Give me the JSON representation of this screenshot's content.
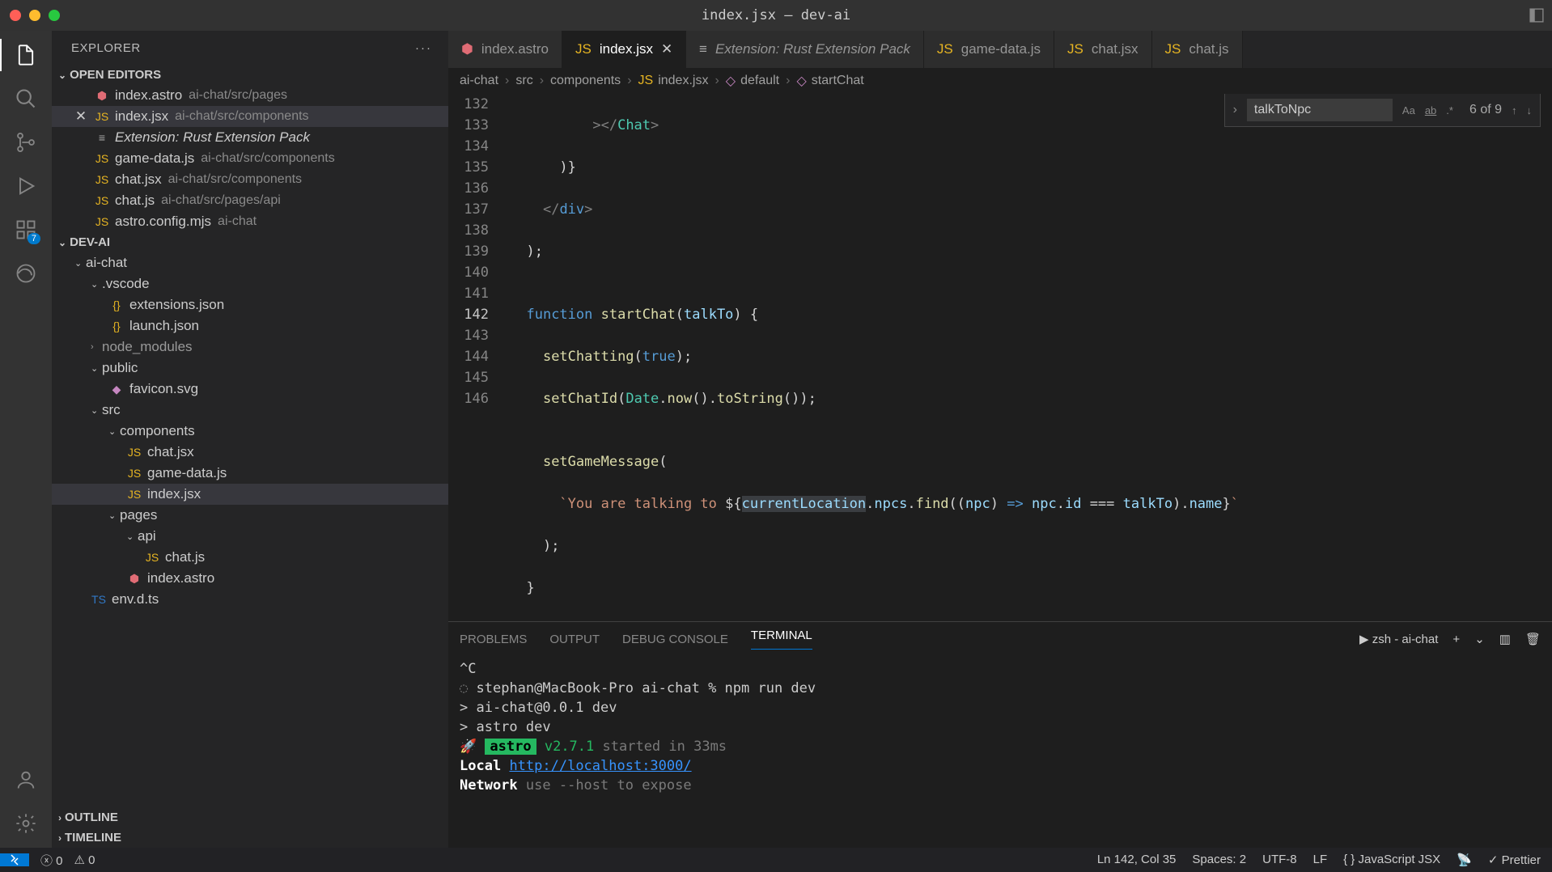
{
  "window": {
    "title": "index.jsx — dev-ai"
  },
  "sidebar": {
    "title": "EXPLORER",
    "sections": {
      "openEditors": "OPEN EDITORS",
      "project": "DEV-AI",
      "outline": "OUTLINE",
      "timeline": "TIMELINE"
    },
    "openEditors": [
      {
        "name": "index.astro",
        "desc": "ai-chat/src/pages",
        "dirty": false,
        "iconColor": "#e06c75"
      },
      {
        "name": "index.jsx",
        "desc": "ai-chat/src/components",
        "dirty": false,
        "iconColor": "#e6b422",
        "active": true
      },
      {
        "name": "Extension: Rust Extension Pack",
        "desc": "",
        "dirty": false,
        "italic": true,
        "iconColor": "#aaa"
      },
      {
        "name": "game-data.js",
        "desc": "ai-chat/src/components",
        "dirty": false,
        "iconColor": "#e6b422"
      },
      {
        "name": "chat.jsx",
        "desc": "ai-chat/src/components",
        "dirty": false,
        "iconColor": "#e6b422"
      },
      {
        "name": "chat.js",
        "desc": "ai-chat/src/pages/api",
        "dirty": false,
        "iconColor": "#e6b422"
      },
      {
        "name": "astro.config.mjs",
        "desc": "ai-chat",
        "dirty": false,
        "iconColor": "#e6b422"
      }
    ],
    "tree": {
      "ai-chat": {
        ".vscode": [
          "extensions.json",
          "launch.json"
        ],
        "node_modules": "collapsed",
        "public": [
          "favicon.svg"
        ],
        "src": {
          "components": [
            "chat.jsx",
            "game-data.js",
            "index.jsx"
          ],
          "pages": {
            "api": [
              "chat.js"
            ],
            "_files": [
              "index.astro"
            ]
          }
        },
        "_files": [
          "env.d.ts"
        ]
      }
    }
  },
  "tabs": [
    {
      "label": "index.astro",
      "icon": "astro"
    },
    {
      "label": "index.jsx",
      "icon": "js",
      "active": true
    },
    {
      "label": "Extension: Rust Extension Pack",
      "icon": "ext",
      "italic": true
    },
    {
      "label": "game-data.js",
      "icon": "js"
    },
    {
      "label": "chat.jsx",
      "icon": "js"
    },
    {
      "label": "chat.js",
      "icon": "js"
    }
  ],
  "breadcrumbs": [
    "ai-chat",
    "src",
    "components",
    "index.jsx",
    "default",
    "startChat"
  ],
  "find": {
    "query": "talkToNpc",
    "count": "6 of 9"
  },
  "editor": {
    "startLine": 132,
    "currentLine": 142,
    "lines": [
      "            ></Chat>",
      "        )}",
      "      </div>",
      "    );",
      "",
      "    function startChat(talkTo) {",
      "      setChatting(true);",
      "      setChatId(Date.now().toString());",
      "",
      "      setGameMessage(",
      "        `You are talking to ${currentLocation.npcs.find((npc) => npc.id === talkTo).name}`",
      "      );",
      "    }",
      "  }",
      ""
    ]
  },
  "panel": {
    "tabs": [
      "PROBLEMS",
      "OUTPUT",
      "DEBUG CONSOLE",
      "TERMINAL"
    ],
    "activeTab": "TERMINAL",
    "shell": "zsh - ai-chat"
  },
  "terminal": {
    "lines": [
      "^C",
      "stephan@MacBook-Pro ai-chat % npm run dev",
      "",
      "> ai-chat@0.0.1 dev",
      "> astro dev",
      "",
      "🚀 astro v2.7.1 started in 33ms",
      "",
      "   Local    http://localhost:3000/",
      "   Network  use --host to expose"
    ],
    "localLabel": "Local",
    "networkLabel": "Network",
    "localUrl": "http://localhost:3000/",
    "networkHint": "use --host to expose",
    "astroBadge": "astro",
    "astroVersion": "v2.7.1",
    "astroStarted": "started in 33ms",
    "prompt": "stephan@MacBook-Pro ai-chat % npm run dev",
    "runLine1": "> ai-chat@0.0.1 dev",
    "runLine2": "> astro dev"
  },
  "status": {
    "errors": "0",
    "warnings": "0",
    "cursor": "Ln 142, Col 35",
    "spaces": "Spaces: 2",
    "encoding": "UTF-8",
    "eol": "LF",
    "language": "JavaScript JSX",
    "prettier": "Prettier"
  },
  "badge": "7"
}
